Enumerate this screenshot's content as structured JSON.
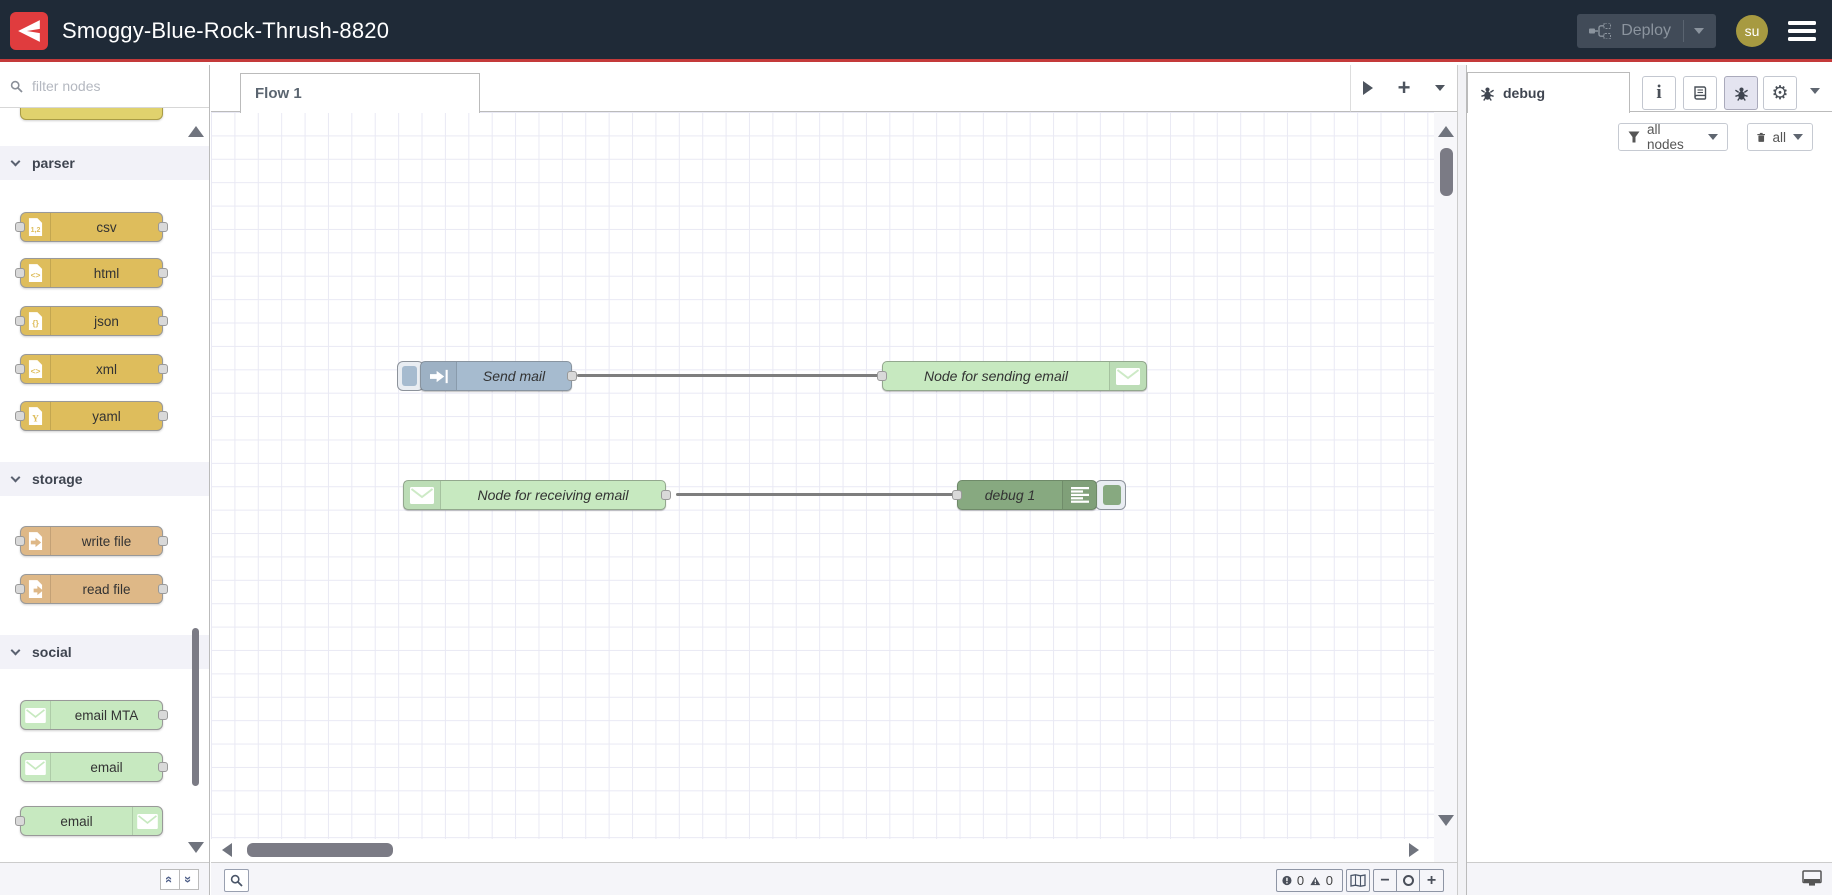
{
  "header": {
    "title": "Smoggy-Blue-Rock-Thrush-8820",
    "deploy_label": "Deploy",
    "avatar_initials": "su"
  },
  "palette": {
    "search_placeholder": "filter nodes",
    "categories": [
      {
        "label": "parser",
        "nodes": [
          {
            "label": "csv",
            "icon": "csv-file-icon"
          },
          {
            "label": "html",
            "icon": "html-file-icon"
          },
          {
            "label": "json",
            "icon": "json-file-icon"
          },
          {
            "label": "xml",
            "icon": "xml-file-icon"
          },
          {
            "label": "yaml",
            "icon": "yaml-file-icon"
          }
        ]
      },
      {
        "label": "storage",
        "nodes": [
          {
            "label": "write file",
            "icon": "write-file-icon"
          },
          {
            "label": "read file",
            "icon": "read-file-icon"
          }
        ]
      },
      {
        "label": "social",
        "nodes": [
          {
            "label": "email MTA",
            "icon": "envelope-icon"
          },
          {
            "label": "email",
            "icon": "envelope-icon"
          },
          {
            "label": "email",
            "icon": "envelope-icon"
          }
        ]
      }
    ]
  },
  "workspace": {
    "tab_label": "Flow 1",
    "nodes": [
      {
        "label": "Send mail",
        "type": "inject"
      },
      {
        "label": "Node for sending email",
        "type": "email out"
      },
      {
        "label": "Node for receiving email",
        "type": "email in"
      },
      {
        "label": "debug 1",
        "type": "debug"
      }
    ],
    "status": {
      "errors": "0",
      "warnings": "0"
    }
  },
  "debug_panel": {
    "tab_label": "debug",
    "filter_button": "all nodes",
    "clear_button": "all"
  },
  "icons": {
    "plus": "+",
    "minus": "−",
    "gear": "⚙",
    "info": "i",
    "collapse_all": "«",
    "expand_all": "»"
  },
  "colors": {
    "accent_red": "#c43a3a",
    "header_bg": "#1f2a37",
    "inject_node": "#a6bbcf",
    "parser_node": "#debd5c",
    "storage_node": "#deb887",
    "social_node": "#c7e9c0",
    "debug_node": "#87a980"
  }
}
